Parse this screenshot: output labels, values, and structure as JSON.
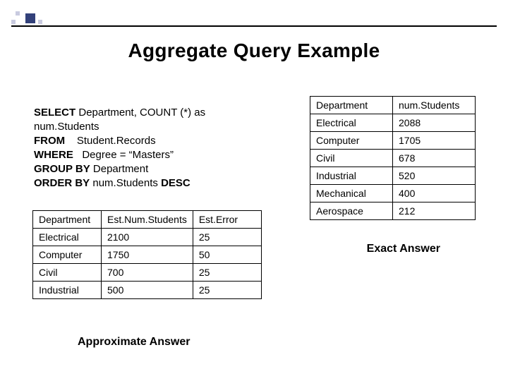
{
  "title": "Aggregate Query Example",
  "sql": {
    "lines": [
      {
        "kw": "SELECT",
        "rest": " Department, COUNT (*) as"
      },
      {
        "kw": "",
        "rest": "num.Students"
      },
      {
        "kw": "FROM",
        "rest": "    Student.Records"
      },
      {
        "kw": "WHERE",
        "rest": "   Degree = “Masters”"
      },
      {
        "kw": "GROUP BY",
        "rest": " Department"
      },
      {
        "kw": "ORDER BY",
        "rest": " num.Students ",
        "kw2": "DESC"
      }
    ]
  },
  "approx": {
    "label": "Approximate Answer",
    "headers": [
      "Department",
      "Est.Num.Students",
      "Est.Error"
    ],
    "rows": [
      [
        "Electrical",
        "2100",
        "25"
      ],
      [
        "Computer",
        "1750",
        "50"
      ],
      [
        "Civil",
        "700",
        "25"
      ],
      [
        "Industrial",
        "500",
        "25"
      ]
    ]
  },
  "exact": {
    "label": "Exact Answer",
    "headers": [
      "Department",
      "num.Students"
    ],
    "rows": [
      [
        "Electrical",
        "2088"
      ],
      [
        "Computer",
        "1705"
      ],
      [
        "Civil",
        "678"
      ],
      [
        "Industrial",
        "520"
      ],
      [
        "Mechanical",
        "400"
      ],
      [
        "Aerospace",
        "212"
      ]
    ]
  }
}
